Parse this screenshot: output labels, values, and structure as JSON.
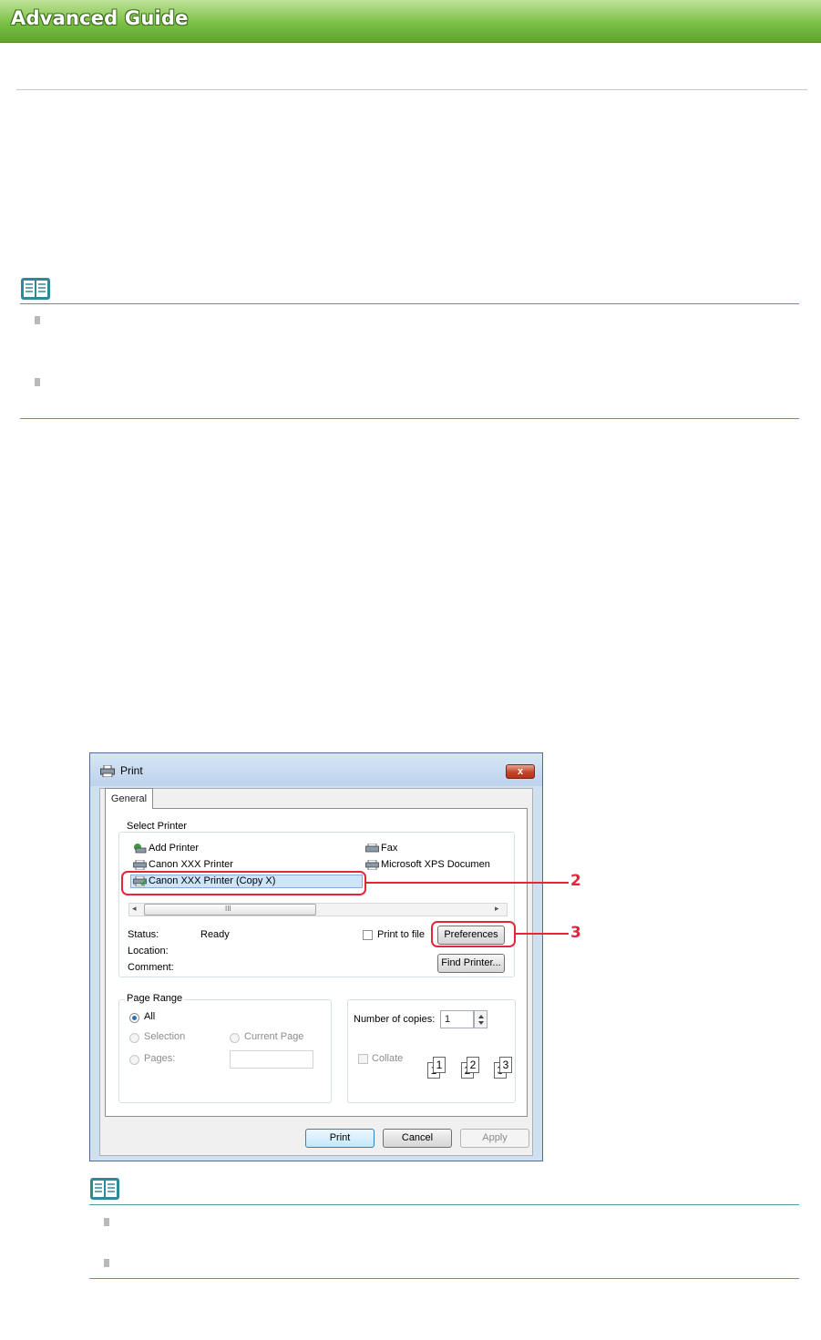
{
  "header": {
    "title": "Advanced Guide"
  },
  "dialog": {
    "title": "Print",
    "close_glyph": "x",
    "tab": "General",
    "select_printer": {
      "label": "Select Printer",
      "printers_left": [
        "Add Printer",
        "Canon XXX Printer",
        "Canon XXX Printer (Copy  X)"
      ],
      "printers_right": [
        "Fax",
        "Microsoft XPS Documen"
      ],
      "selected_index": 2,
      "scroll_left_glyph": "◂",
      "scroll_grip": "III",
      "scroll_right_glyph": "▸"
    },
    "status_label": "Status:",
    "status_value": "Ready",
    "location_label": "Location:",
    "comment_label": "Comment:",
    "print_to_file": "Print to file",
    "preferences_button": "Preferences",
    "find_printer_button": "Find Printer...",
    "page_range": {
      "label": "Page Range",
      "all": "All",
      "selection": "Selection",
      "current_page": "Current Page",
      "pages": "Pages:",
      "pages_value": ""
    },
    "copies": {
      "label": "Number of copies:",
      "value": "1",
      "collate": "Collate",
      "collate_pages": [
        "1",
        "1",
        "2",
        "2",
        "3",
        "3"
      ]
    },
    "buttons": {
      "print": "Print",
      "cancel": "Cancel",
      "apply": "Apply"
    }
  },
  "callouts": [
    "2",
    "3"
  ],
  "colors": {
    "header_green": "#7bc045",
    "callout_red": "#e8243a",
    "note_rule": "#4e9aa7"
  }
}
